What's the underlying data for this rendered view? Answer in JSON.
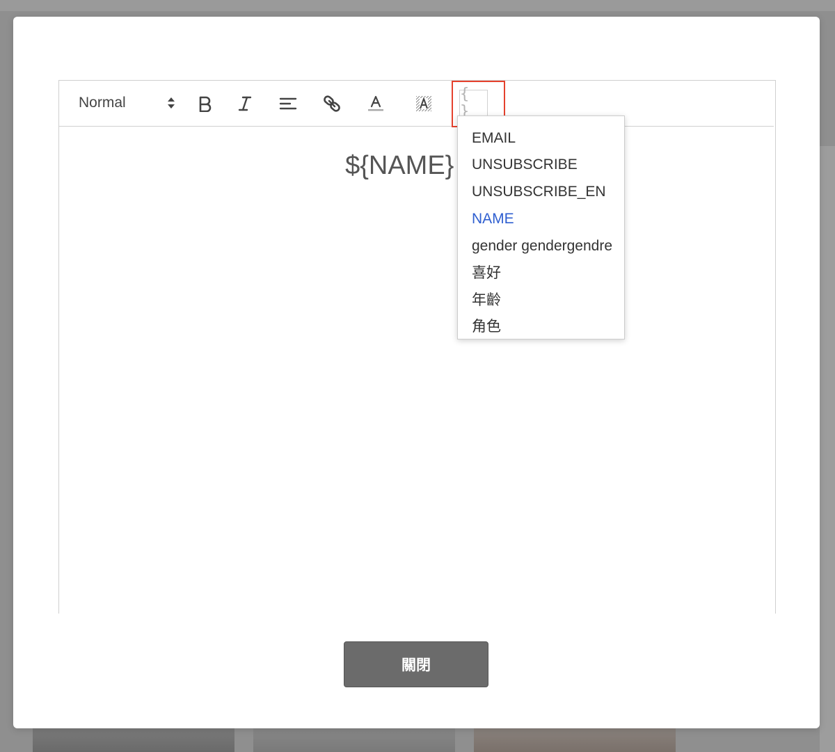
{
  "toolbar": {
    "header_select_value": "Normal",
    "variable_button_label": "{ }",
    "icons": {
      "bold": "bold-icon",
      "italic": "italic-icon",
      "align": "align-left-icon",
      "link": "link-icon",
      "text_color": "text-color-icon",
      "background_color": "background-color-icon"
    }
  },
  "editor": {
    "content_text": "${NAME} 你"
  },
  "variable_dropdown": {
    "items": [
      {
        "label": "EMAIL"
      },
      {
        "label": "UNSUBSCRIBE"
      },
      {
        "label": "UNSUBSCRIBE_EN"
      },
      {
        "label": "NAME"
      },
      {
        "label": "gender gendergendre"
      },
      {
        "label": "喜好"
      },
      {
        "label": "年齡"
      },
      {
        "label": "角色"
      }
    ],
    "active_item": "NAME",
    "active_color": "#2f5fd0",
    "highlight_color": "#e5412d"
  },
  "footer": {
    "close_label": "關閉"
  }
}
